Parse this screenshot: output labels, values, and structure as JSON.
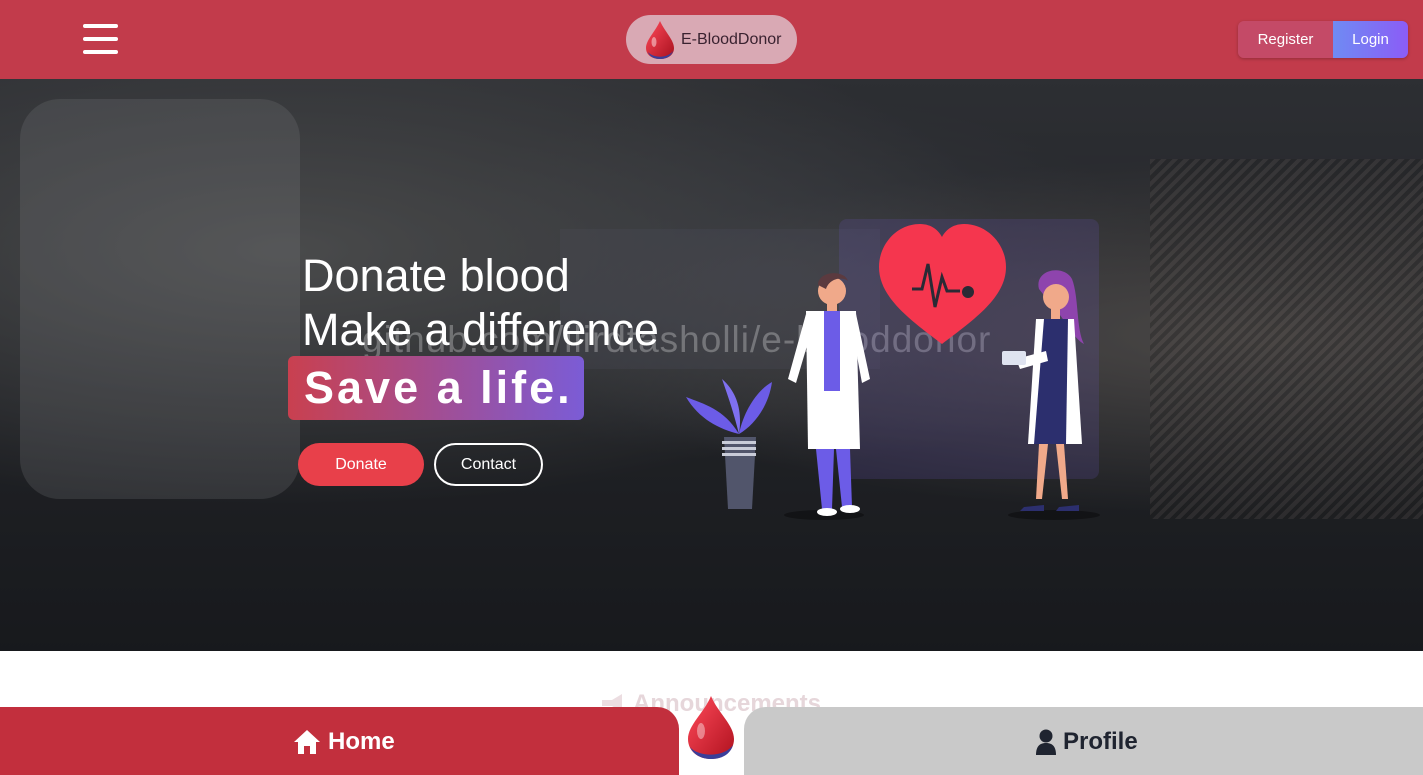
{
  "header": {
    "menu_icon": "hamburger-icon",
    "brand_name": "E-BloodDonor",
    "brand_icon": "blood-drop-icon",
    "register_label": "Register",
    "login_label": "Login"
  },
  "hero": {
    "line1": "Donate blood",
    "line2": "Make a difference",
    "highlight": "Save a life.",
    "watermark": "github.com/ilirdtasholli/e-blooddonor",
    "donate_label": "Donate",
    "contact_label": "Contact"
  },
  "section": {
    "announcements_title": "Announcements",
    "announcements_icon": "megaphone-icon"
  },
  "bottom_nav": {
    "home_label": "Home",
    "home_icon": "home-icon",
    "profile_label": "Profile",
    "profile_icon": "user-icon",
    "center_icon": "blood-drop-icon"
  },
  "colors": {
    "primary_red": "#c23b4b",
    "cta_red": "#e8404a",
    "accent_purple": "#7b5cd6",
    "profile_grey": "#c9c9c9"
  }
}
